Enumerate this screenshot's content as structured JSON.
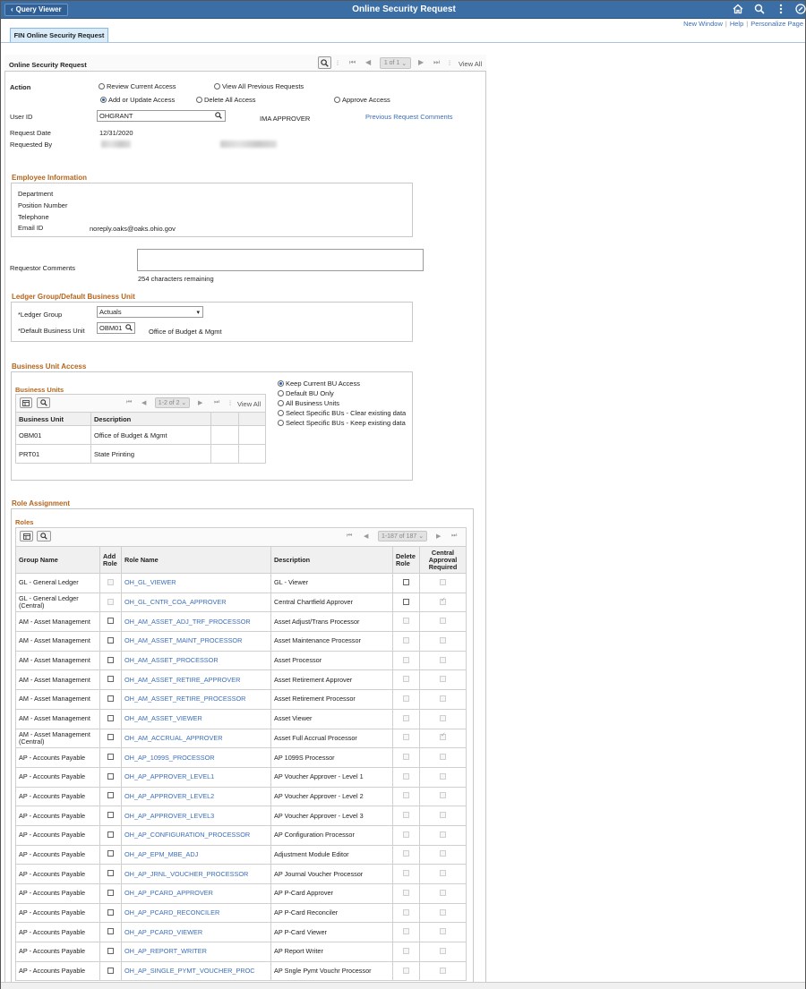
{
  "topbar": {
    "back_label": "Query Viewer",
    "title": "Online Security Request"
  },
  "links": [
    "New Window",
    "Help",
    "Personalize Page"
  ],
  "tab": {
    "label": "FIN Online Security Request"
  },
  "panel": {
    "title": "Online Security Request",
    "pager": "1 of 1",
    "view_all": "View All"
  },
  "action": {
    "label": "Action",
    "options": {
      "review": "Review Current Access",
      "view_prev": "View All Previous Requests",
      "add": "Add or Update Access",
      "delete": "Delete All Access",
      "approve": "Approve Access"
    },
    "selected": "add"
  },
  "user": {
    "user_id_label": "User ID",
    "user_id": "OHGRANT",
    "approver": "IMA APPROVER",
    "prev_comments": "Previous Request Comments",
    "request_date_label": "Request Date",
    "request_date": "12/31/2020",
    "requested_by_label": "Requested By"
  },
  "employee": {
    "title": "Employee Information",
    "department_label": "Department",
    "position_label": "Position Number",
    "telephone_label": "Telephone",
    "email_label": "Email ID",
    "email": "noreply.oaks@oaks.ohio.gov"
  },
  "comments": {
    "label": "Requestor Comments",
    "remaining": "254 characters remaining"
  },
  "ledger": {
    "title": "Ledger Group/Default Business Unit",
    "group_label": "*Ledger Group",
    "group_value": "Actuals",
    "bu_label": "*Default Business Unit",
    "bu_value": "OBM01",
    "bu_desc": "Office of Budget & Mgmt"
  },
  "bu_access": {
    "title": "Business Unit Access",
    "grid_title": "Business Units",
    "pager": "1-2 of 2",
    "view_all": "View All",
    "headers": [
      "Business Unit",
      "Description"
    ],
    "rows": [
      {
        "unit": "OBM01",
        "desc": "Office of Budget & Mgmt"
      },
      {
        "unit": "PRT01",
        "desc": "State Printing"
      }
    ],
    "options": [
      "Keep Current BU Access",
      "Default BU Only",
      "All Business Units",
      "Select Specific BUs - Clear existing data",
      "Select Specific BUs - Keep existing data"
    ],
    "selected": 0
  },
  "roles": {
    "title": "Role Assignment",
    "grid_title": "Roles",
    "pager": "1-187 of 187",
    "headers": {
      "group": "Group Name",
      "add": "Add Role",
      "role": "Role Name",
      "desc": "Description",
      "delete": "Delete Role",
      "central": "Central Approval Required"
    },
    "rows": [
      {
        "group": "GL - General Ledger",
        "role": "OH_GL_VIEWER",
        "desc": "GL -  Viewer",
        "add": "dis",
        "del": "on",
        "central": "off"
      },
      {
        "group": "GL - General Ledger (Central)",
        "role": "OH_GL_CNTR_COA_APPROVER",
        "desc": "Central Chartfield Approver",
        "add": "dis",
        "del": "on",
        "central": "chk"
      },
      {
        "group": "AM - Asset Management",
        "role": "OH_AM_ASSET_ADJ_TRF_PROCESSOR",
        "desc": "Asset Adjust/Trans Processor",
        "add": "on",
        "del": "dis",
        "central": "off"
      },
      {
        "group": "AM - Asset Management",
        "role": "OH_AM_ASSET_MAINT_PROCESSOR",
        "desc": "Asset Maintenance Processor",
        "add": "on",
        "del": "dis",
        "central": "off"
      },
      {
        "group": "AM - Asset Management",
        "role": "OH_AM_ASSET_PROCESSOR",
        "desc": "Asset Processor",
        "add": "on",
        "del": "dis",
        "central": "off"
      },
      {
        "group": "AM - Asset Management",
        "role": "OH_AM_ASSET_RETIRE_APPROVER",
        "desc": "Asset Retirement Approver",
        "add": "on",
        "del": "dis",
        "central": "off"
      },
      {
        "group": "AM - Asset Management",
        "role": "OH_AM_ASSET_RETIRE_PROCESSOR",
        "desc": "Asset Retirement Processor",
        "add": "on",
        "del": "dis",
        "central": "off"
      },
      {
        "group": "AM - Asset Management",
        "role": "OH_AM_ASSET_VIEWER",
        "desc": "Asset Viewer",
        "add": "on",
        "del": "dis",
        "central": "off"
      },
      {
        "group": "AM - Asset Management (Central)",
        "role": "OH_AM_ACCRUAL_APPROVER",
        "desc": "Asset Full Accrual Processor",
        "add": "on",
        "del": "dis",
        "central": "chk"
      },
      {
        "group": "AP - Accounts Payable",
        "role": "OH_AP_1099S_PROCESSOR",
        "desc": "AP 1099S Processor",
        "add": "on",
        "del": "dis",
        "central": "off"
      },
      {
        "group": "AP - Accounts Payable",
        "role": "OH_AP_APPROVER_LEVEL1",
        "desc": "AP Voucher Approver - Level 1",
        "add": "on",
        "del": "dis",
        "central": "off"
      },
      {
        "group": "AP - Accounts Payable",
        "role": "OH_AP_APPROVER_LEVEL2",
        "desc": "AP Voucher Approver - Level 2",
        "add": "on",
        "del": "dis",
        "central": "off"
      },
      {
        "group": "AP - Accounts Payable",
        "role": "OH_AP_APPROVER_LEVEL3",
        "desc": "AP Voucher Approver - Level 3",
        "add": "on",
        "del": "dis",
        "central": "off"
      },
      {
        "group": "AP - Accounts Payable",
        "role": "OH_AP_CONFIGURATION_PROCESSOR",
        "desc": "AP Configuration Processor",
        "add": "on",
        "del": "dis",
        "central": "off"
      },
      {
        "group": "AP - Accounts Payable",
        "role": "OH_AP_EPM_MBE_ADJ",
        "desc": "Adjustment Module Editor",
        "add": "on",
        "del": "dis",
        "central": "off"
      },
      {
        "group": "AP - Accounts Payable",
        "role": "OH_AP_JRNL_VOUCHER_PROCESSOR",
        "desc": "AP Journal Voucher Processor",
        "add": "on",
        "del": "dis",
        "central": "off"
      },
      {
        "group": "AP - Accounts Payable",
        "role": "OH_AP_PCARD_APPROVER",
        "desc": "AP P-Card Approver",
        "add": "on",
        "del": "dis",
        "central": "off"
      },
      {
        "group": "AP - Accounts Payable",
        "role": "OH_AP_PCARD_RECONCILER",
        "desc": "AP P-Card Reconciler",
        "add": "on",
        "del": "dis",
        "central": "off"
      },
      {
        "group": "AP - Accounts Payable",
        "role": "OH_AP_PCARD_VIEWER",
        "desc": "AP P-Card Viewer",
        "add": "on",
        "del": "dis",
        "central": "off"
      },
      {
        "group": "AP - Accounts Payable",
        "role": "OH_AP_REPORT_WRITER",
        "desc": "AP Report Writer",
        "add": "on",
        "del": "dis",
        "central": "off"
      },
      {
        "group": "AP - Accounts Payable",
        "role": "OH_AP_SINGLE_PYMT_VOUCHER_PROC",
        "desc": "AP Sngle Pymt Vouchr Processor",
        "add": "on",
        "del": "dis",
        "central": "off"
      }
    ]
  }
}
